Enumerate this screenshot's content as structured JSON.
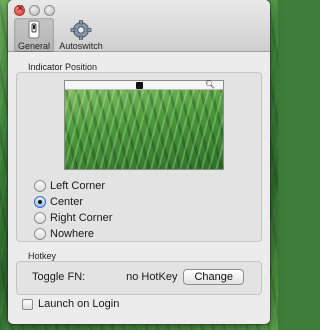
{
  "toolbar": {
    "tabs": [
      {
        "label": "General",
        "icon": "switch-icon",
        "selected": true
      },
      {
        "label": "Autoswitch",
        "icon": "gear-icon",
        "selected": false
      }
    ]
  },
  "indicator": {
    "title": "Indicator Position",
    "options": [
      {
        "label": "Left Corner",
        "selected": false
      },
      {
        "label": "Center",
        "selected": true
      },
      {
        "label": "Right Corner",
        "selected": false
      },
      {
        "label": "Nowhere",
        "selected": false
      }
    ]
  },
  "hotkey": {
    "title": "Hotkey",
    "toggle_label": "Toggle FN:",
    "value": "no HotKey",
    "change_label": "Change"
  },
  "launch_on_login": {
    "label": "Launch on Login",
    "checked": false
  },
  "colors": {
    "accent": "#3c6bc4",
    "window_bg": "#ececec",
    "close": "#d6342a"
  }
}
